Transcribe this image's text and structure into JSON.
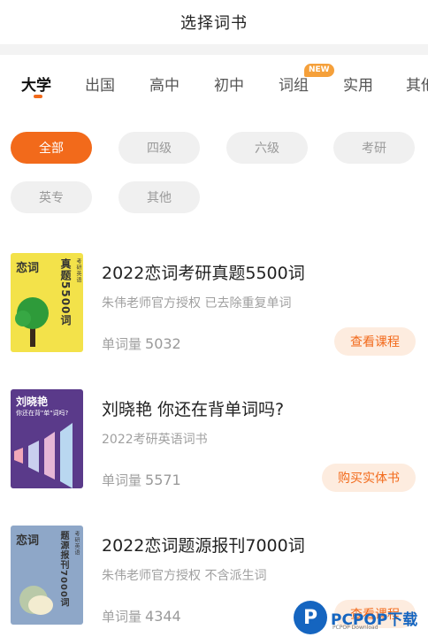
{
  "header": {
    "title": "选择词书"
  },
  "tabs": [
    {
      "label": "大学",
      "active": true
    },
    {
      "label": "出国"
    },
    {
      "label": "高中"
    },
    {
      "label": "初中"
    },
    {
      "label": "词组",
      "badge": "NEW"
    },
    {
      "label": "实用"
    },
    {
      "label": "其他"
    }
  ],
  "filters": [
    {
      "label": "全部",
      "active": true
    },
    {
      "label": "四级"
    },
    {
      "label": "六级"
    },
    {
      "label": "考研"
    },
    {
      "label": "英专"
    },
    {
      "label": "其他"
    }
  ],
  "books": [
    {
      "title": "2022恋词考研真题5500词",
      "subtitle": "朱伟老师官方授权 已去除重复单词",
      "count_label": "单词量",
      "count": "5032",
      "button": "查看课程",
      "cover": {
        "title": "恋词",
        "vertical": "真题5500词",
        "small": "考研英语",
        "bg": "#f3e24a"
      }
    },
    {
      "title": "刘晓艳 你还在背单词吗?",
      "subtitle": "2022考研英语词书",
      "count_label": "单词量",
      "count": "5571",
      "button": "购买实体书",
      "cover": {
        "title": "刘晓艳",
        "line2": "你还在背\"单\"词吗?",
        "bg": "#5a3a8a"
      }
    },
    {
      "title": "2022恋词题源报刊7000词",
      "subtitle": "朱伟老师官方授权 不含派生词",
      "count_label": "单词量",
      "count": "4344",
      "button": "查看课程",
      "cover": {
        "title": "恋词",
        "vertical": "题源报刊7000词",
        "small": "考研英语",
        "bg": "#8ea7c8"
      }
    }
  ],
  "watermark": {
    "logo": "P",
    "text": "PCPOP下载",
    "small": "PCPOP Download"
  },
  "colors": {
    "accent": "#f26a1b",
    "button_bg": "#fdecdf",
    "badge": "#f5a03a"
  }
}
